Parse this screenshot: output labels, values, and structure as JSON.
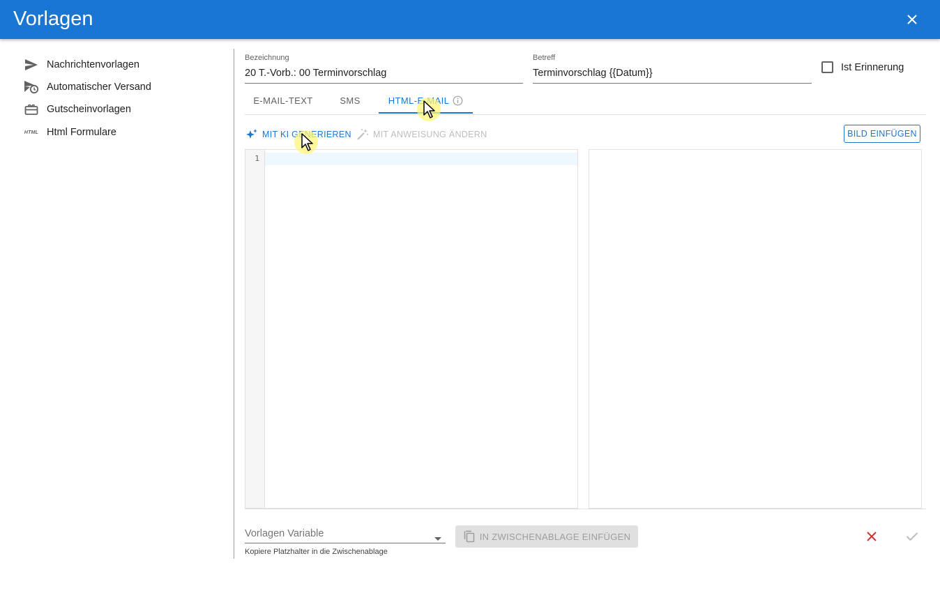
{
  "header": {
    "title": "Vorlagen",
    "close_icon": "close-icon"
  },
  "sidebar": {
    "items": [
      {
        "label": "Nachrichtenvorlagen",
        "icon": "send-icon"
      },
      {
        "label": "Automatischer Versand",
        "icon": "scheduled-send-icon"
      },
      {
        "label": "Gutscheinvorlagen",
        "icon": "gift-card-icon"
      },
      {
        "label": "Html Formulare",
        "icon": "html-icon",
        "icon_text": "HTML"
      }
    ]
  },
  "form": {
    "bezeichnung": {
      "label": "Bezeichnung",
      "value": "20 T.-Vorb.: 00 Terminvorschlag"
    },
    "betreff": {
      "label": "Betreff",
      "value": "Terminvorschlag {{Datum}}"
    },
    "reminder": {
      "label": "Ist Erinnerung",
      "checked": false
    }
  },
  "tabs": [
    {
      "label": "E-MAIL-TEXT",
      "active": false
    },
    {
      "label": "SMS",
      "active": false
    },
    {
      "label": "HTML-E-MAIL",
      "active": true,
      "icon": "info-icon"
    }
  ],
  "toolbar": {
    "generate_label": "MIT KI GENERIEREN",
    "modify_label": "MIT ANWEISUNG ÄNDERN",
    "insert_image_label": "BILD EINFÜGEN"
  },
  "editor": {
    "line_numbers": [
      "1"
    ]
  },
  "bottom": {
    "variable_select_placeholder": "Vorlagen Variable",
    "hint": "Kopiere Platzhalter in die Zwischenablage",
    "copy_label": "IN ZWISCHENABLAGE EINFÜGEN",
    "cancel_icon": "close-icon",
    "confirm_icon": "check-icon"
  },
  "colors": {
    "primary": "#1976d2",
    "danger": "#d32f2f",
    "disabled": "#bdbdbd"
  }
}
